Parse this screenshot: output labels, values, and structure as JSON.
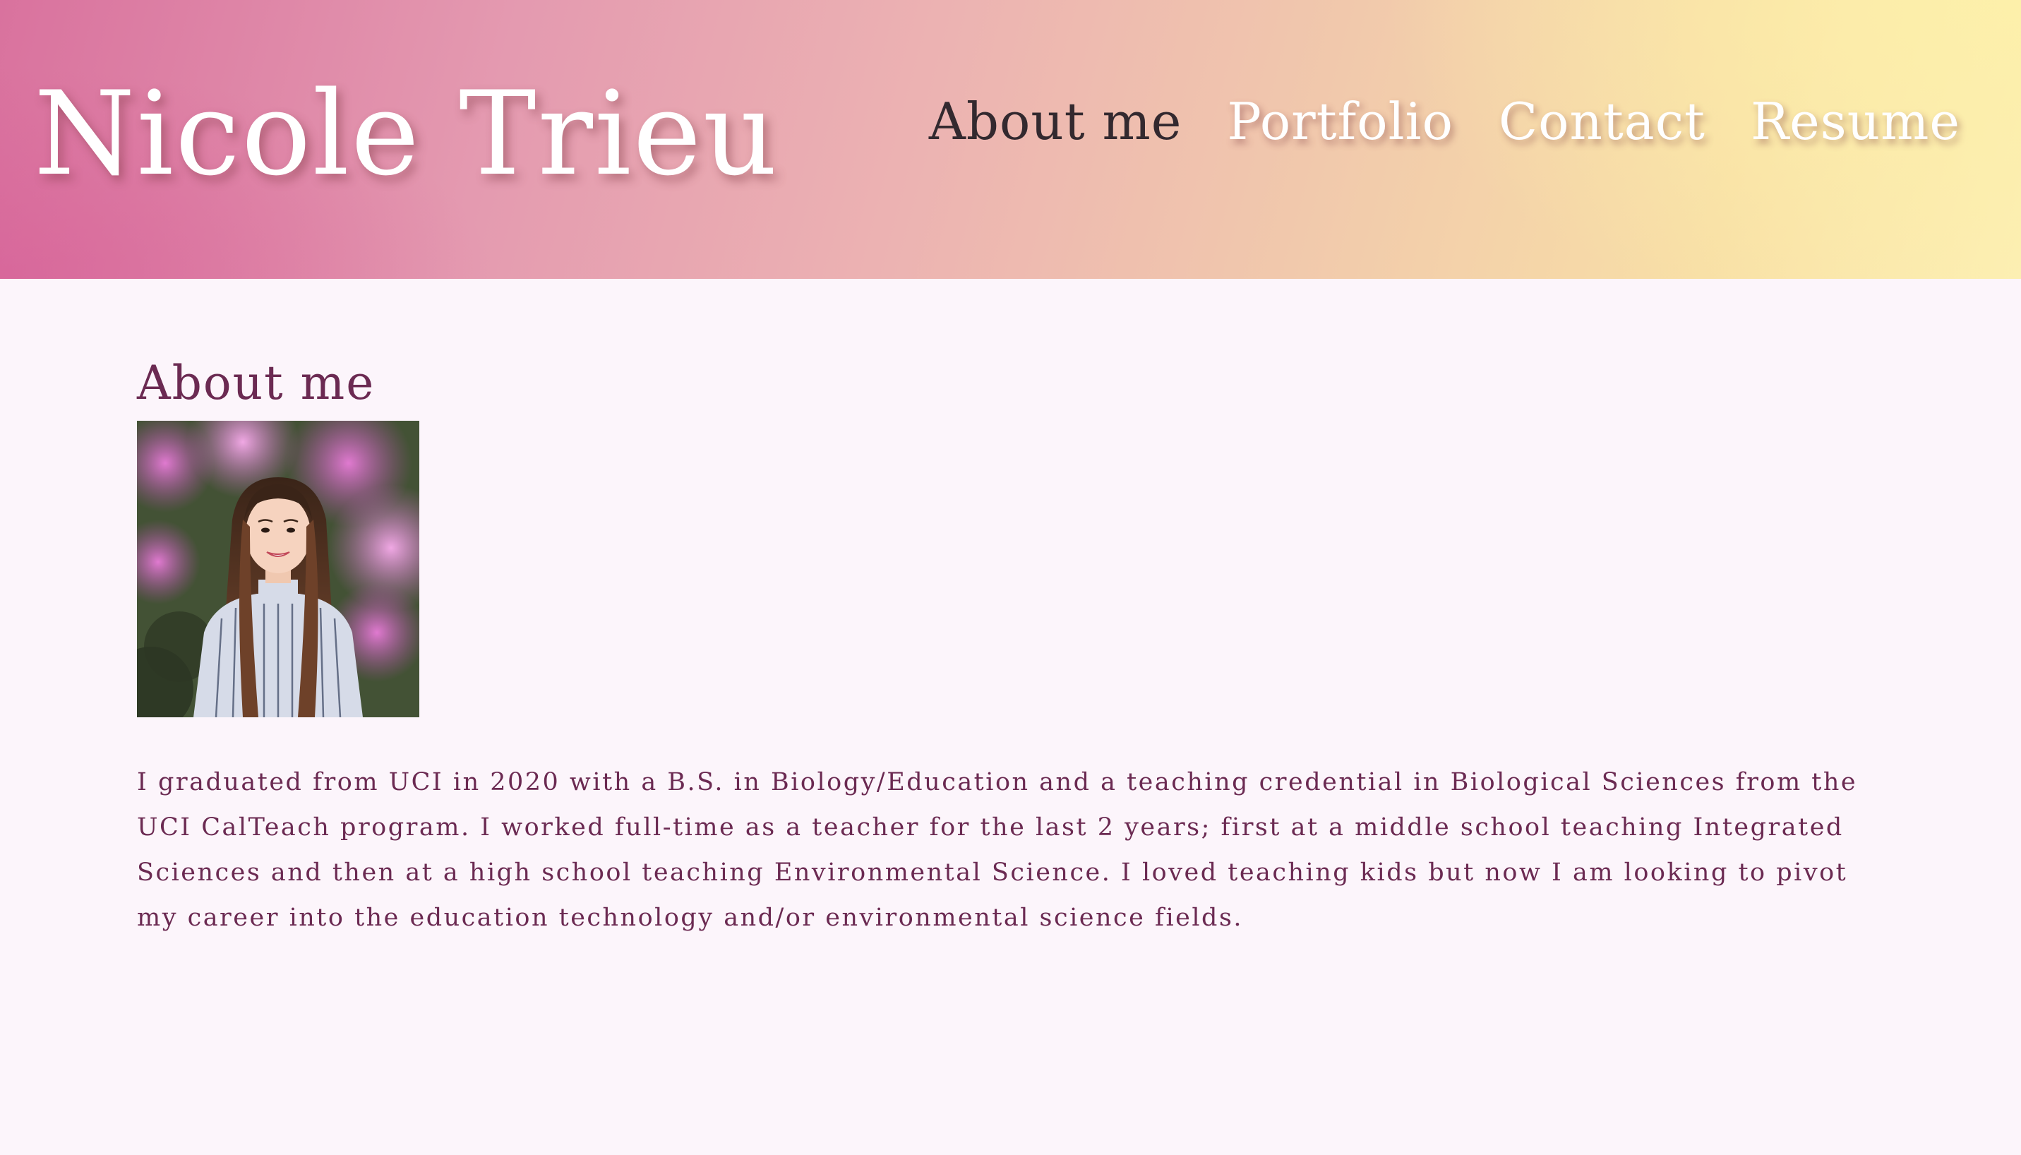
{
  "header": {
    "site_name": "Nicole Trieu",
    "nav": [
      {
        "label": "About me",
        "active": true
      },
      {
        "label": "Portfolio",
        "active": false
      },
      {
        "label": "Contact",
        "active": false
      },
      {
        "label": "Resume",
        "active": false
      }
    ]
  },
  "about": {
    "title": "About me",
    "bio": "I graduated from UCI in 2020 with a B.S. in Biology/Education and a teaching credential in Biological Sciences from the UCI CalTeach program. I worked full-time as a teacher for the last 2 years; first at a middle school teaching Integrated Sciences and then at a high school teaching Environmental Science. I loved teaching kids but now I am looking to pivot my career into the education technology and/or environmental science fields."
  },
  "colors": {
    "active_nav": "#33292f",
    "accent_text": "#6b2a52",
    "page_bg": "#fcf5fb"
  }
}
